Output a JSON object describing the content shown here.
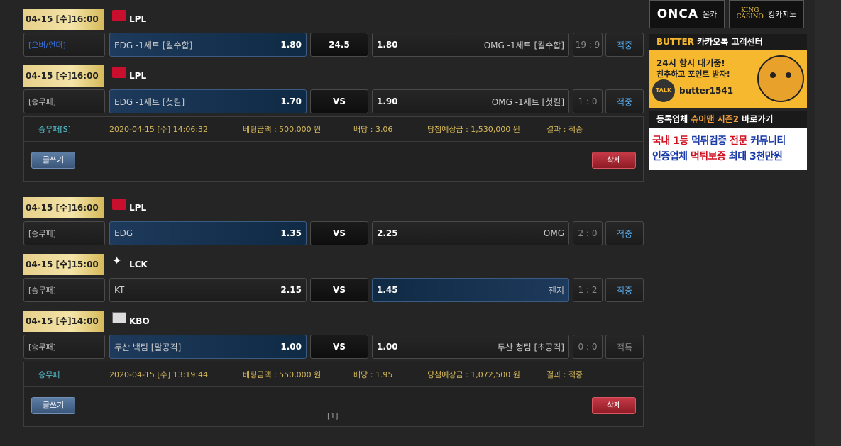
{
  "group1": {
    "games": [
      {
        "date": "04-15 [수]16:00",
        "league": "LPL",
        "league_logo": "lpl",
        "type": "[오버/언더]",
        "type_blue": true,
        "home": "EDG -1세트 [킬수합]",
        "home_odds": "1.80",
        "home_sel": true,
        "mid": "24.5",
        "away": "OMG -1세트 [킬수합]",
        "away_odds": "1.80",
        "away_sel": false,
        "score": "19 : 9",
        "result": "적중"
      },
      {
        "date": "04-15 [수]16:00",
        "league": "LPL",
        "league_logo": "lpl",
        "type": "[승무패]",
        "type_blue": false,
        "home": "EDG -1세트 [첫킬]",
        "home_odds": "1.70",
        "home_sel": true,
        "mid": "VS",
        "away": "OMG -1세트 [첫킬]",
        "away_odds": "1.90",
        "away_sel": false,
        "score": "1 : 0",
        "result": "적중"
      }
    ],
    "bet": {
      "type": "승무패[S]",
      "time": "2020-04-15 [수] 14:06:32",
      "amount": "베팅금액 : 500,000 원",
      "odds": "배당 : 3.06",
      "expected": "당첨예상금 : 1,530,000 원",
      "result": "결과 : 적중"
    }
  },
  "group2": {
    "games": [
      {
        "date": "04-15 [수]16:00",
        "league": "LPL",
        "league_logo": "lpl",
        "type": "[승무패]",
        "type_blue": false,
        "home": "EDG",
        "home_odds": "1.35",
        "home_sel": true,
        "mid": "VS",
        "away": "OMG",
        "away_odds": "2.25",
        "away_sel": false,
        "score": "2 : 0",
        "result": "적중"
      },
      {
        "date": "04-15 [수]15:00",
        "league": "LCK",
        "league_logo": "lck",
        "type": "[승무패]",
        "type_blue": false,
        "home": "KT",
        "home_odds": "2.15",
        "home_sel": false,
        "mid": "VS",
        "away": "젠지",
        "away_odds": "1.45",
        "away_sel": true,
        "score": "1 : 2",
        "result": "적중"
      },
      {
        "date": "04-15 [수]14:00",
        "league": "KBO",
        "league_logo": "kbo",
        "type": "[승무패]",
        "type_blue": false,
        "home": "두산 백팀 [말공격]",
        "home_odds": "1.00",
        "home_sel": true,
        "mid": "VS",
        "away": "두산 청팀 [초공격]",
        "away_odds": "1.00",
        "away_sel": false,
        "score": "0 : 0",
        "result": "적특"
      }
    ],
    "bet": {
      "type": "승무패",
      "time": "2020-04-15 [수] 13:19:44",
      "amount": "베팅금액 : 550,000 원",
      "odds": "배당 : 1.95",
      "expected": "당첨예상금 : 1,072,500 원",
      "result": "결과 : 적중"
    }
  },
  "buttons": {
    "write": "글쓰기",
    "delete": "삭제"
  },
  "pager": "[1]",
  "side": {
    "onca_big": "ONCA",
    "onca_sm": "온카",
    "king_logo_1": "KING",
    "king_logo_2": "CASINO",
    "king_label": "킹카지노",
    "butter_title_1": "BUTTER ",
    "butter_title_2": "카카오톡 고객센터",
    "butter_line1": "24시 항시 대기중!",
    "butter_line2": "친추하고 포인트 받자!",
    "butter_talk": "TALK",
    "butter_id": "butter1541",
    "sure_title_1": "등록업체 ",
    "sure_title_2": "슈어맨 시즌2",
    "sure_title_3": " 바로가기",
    "sure_line1_a": "국내 1등 ",
    "sure_line1_b": "먹튀검증",
    "sure_line1_c": " 전문 ",
    "sure_line1_d": "커뮤니티",
    "sure_line2_a": "인증업체 ",
    "sure_line2_b": "먹튀보증",
    "sure_line2_c": " 최대 3천만원"
  }
}
